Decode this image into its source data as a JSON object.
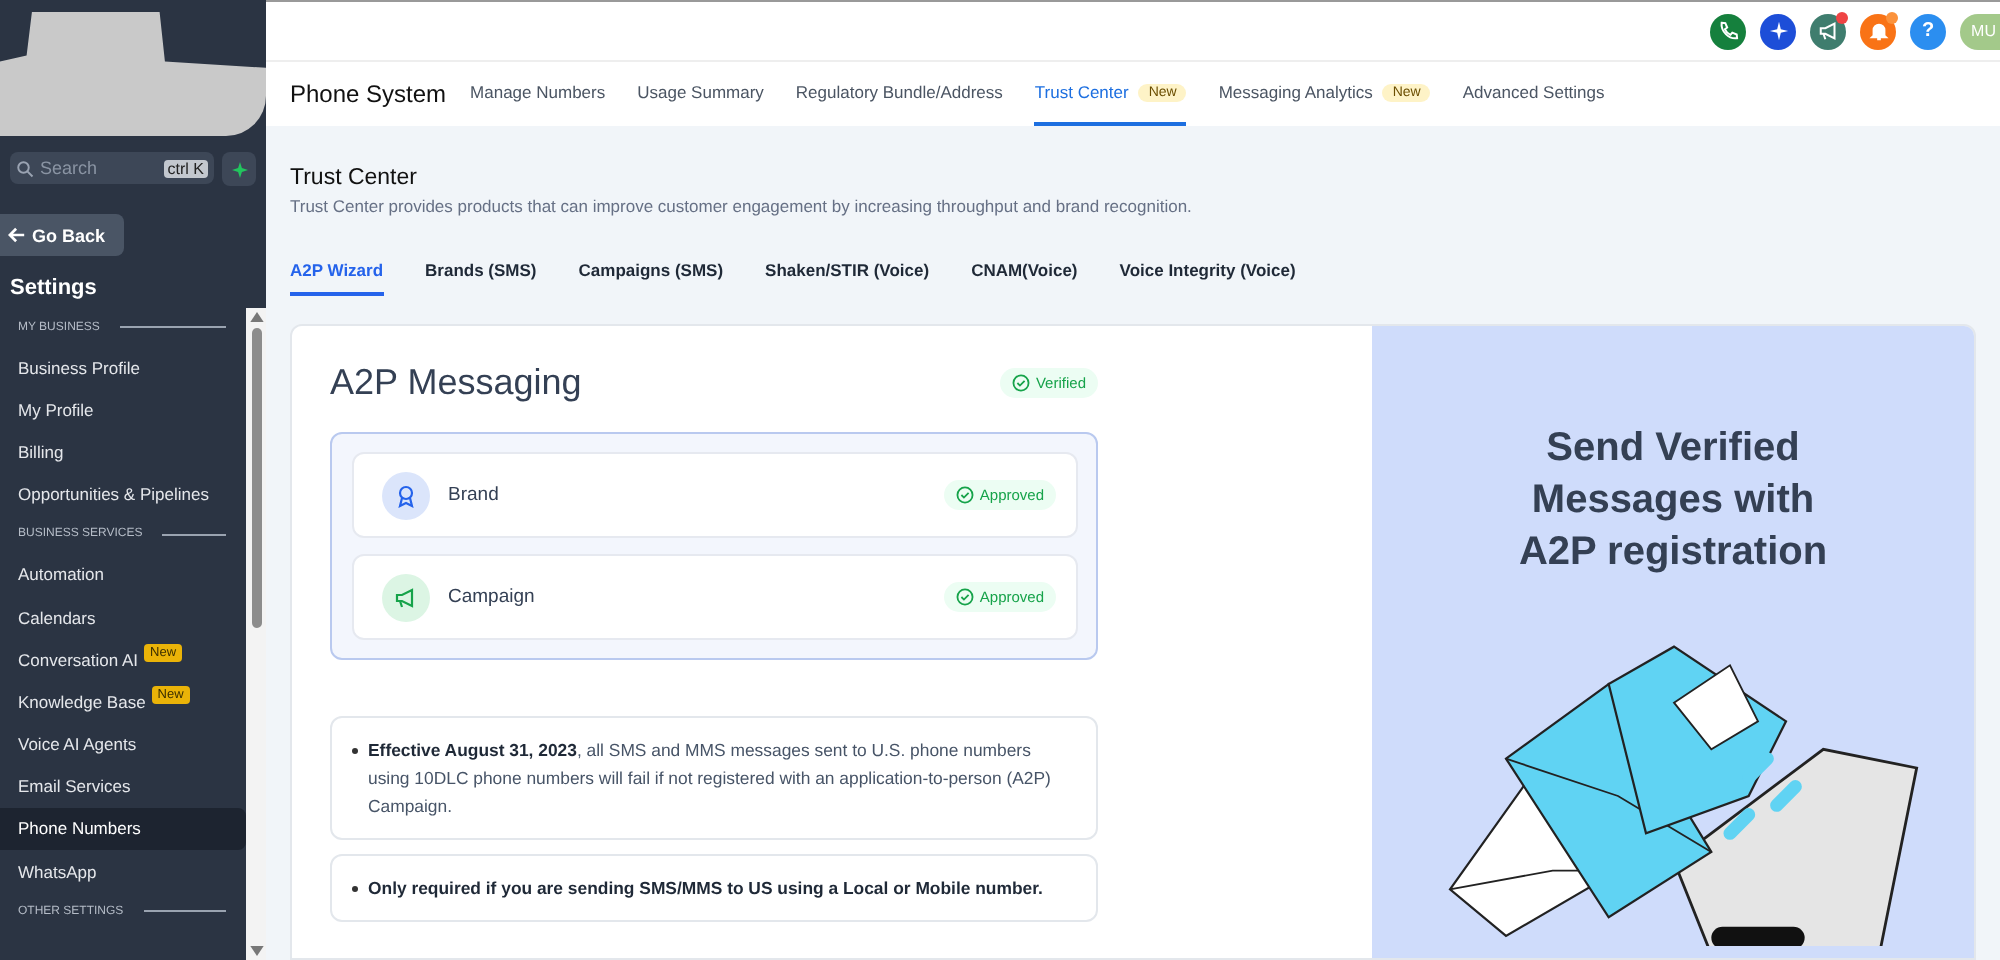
{
  "sidebar": {
    "search": {
      "placeholder": "Search",
      "shortcut": "ctrl K"
    },
    "back_button": "Go Back",
    "title": "Settings",
    "items": [
      {
        "kind": "section",
        "label": "MY BUSINESS"
      },
      {
        "kind": "link",
        "label": "Business Profile",
        "selected": false
      },
      {
        "kind": "link",
        "label": "My Profile",
        "selected": false
      },
      {
        "kind": "link",
        "label": "Billing",
        "selected": false
      },
      {
        "kind": "link",
        "label": "Opportunities & Pipelines",
        "selected": false
      },
      {
        "kind": "section",
        "label": "BUSINESS SERVICES"
      },
      {
        "kind": "link",
        "label": "Automation",
        "selected": false
      },
      {
        "kind": "link",
        "label": "Calendars",
        "selected": false
      },
      {
        "kind": "link",
        "label": "Conversation AI",
        "badge": "New",
        "selected": false
      },
      {
        "kind": "link",
        "label": "Knowledge Base",
        "badge": "New",
        "selected": false
      },
      {
        "kind": "link",
        "label": "Voice AI Agents",
        "selected": false
      },
      {
        "kind": "link",
        "label": "Email Services",
        "selected": false
      },
      {
        "kind": "link",
        "label": "Phone Numbers",
        "selected": true
      },
      {
        "kind": "link",
        "label": "WhatsApp",
        "selected": false
      },
      {
        "kind": "section",
        "label": "OTHER SETTINGS"
      }
    ]
  },
  "header_buttons": [
    {
      "kind": "phone",
      "dot": false
    },
    {
      "kind": "sparkle",
      "dot": false
    },
    {
      "kind": "megaphone",
      "dot": true
    },
    {
      "kind": "bell",
      "dot": true
    },
    {
      "kind": "help",
      "label": "?",
      "dot": false
    }
  ],
  "avatar": "MU",
  "nav": {
    "title": "Phone System",
    "tabs": [
      {
        "label": "Manage Numbers",
        "selected": false
      },
      {
        "label": "Usage Summary",
        "selected": false
      },
      {
        "label": "Regulatory Bundle/Address",
        "selected": false
      },
      {
        "label": "Trust Center",
        "badge": "New",
        "selected": true
      },
      {
        "label": "Messaging Analytics",
        "badge": "New",
        "selected": false
      },
      {
        "label": "Advanced Settings",
        "selected": false
      }
    ]
  },
  "page": {
    "title": "Trust Center",
    "description": "Trust Center provides products that can improve customer engagement by increasing throughput and brand recognition.",
    "tabs": [
      {
        "label": "A2P Wizard",
        "selected": true
      },
      {
        "label": "Brands (SMS)",
        "selected": false
      },
      {
        "label": "Campaigns (SMS)",
        "selected": false
      },
      {
        "label": "Shaken/STIR (Voice)",
        "selected": false
      },
      {
        "label": "CNAM(Voice)",
        "selected": false
      },
      {
        "label": "Voice Integrity (Voice)",
        "selected": false
      }
    ]
  },
  "card": {
    "title": "A2P Messaging",
    "status": "Verified",
    "steps": [
      {
        "kind": "brand",
        "label": "Brand",
        "status": "Approved"
      },
      {
        "kind": "campaign",
        "label": "Campaign",
        "status": "Approved"
      }
    ],
    "notes": [
      "**Effective August 31, 2023**, all SMS and MMS messages sent to U.S. phone numbers using 10DLC phone numbers will fail if not registered with an application-to-person (A2P) Campaign.",
      "**Only required if you are sending SMS/MMS to US using a Local or Mobile number.**"
    ]
  },
  "promo": {
    "title": "Send Verified Messages with A2P registration"
  }
}
